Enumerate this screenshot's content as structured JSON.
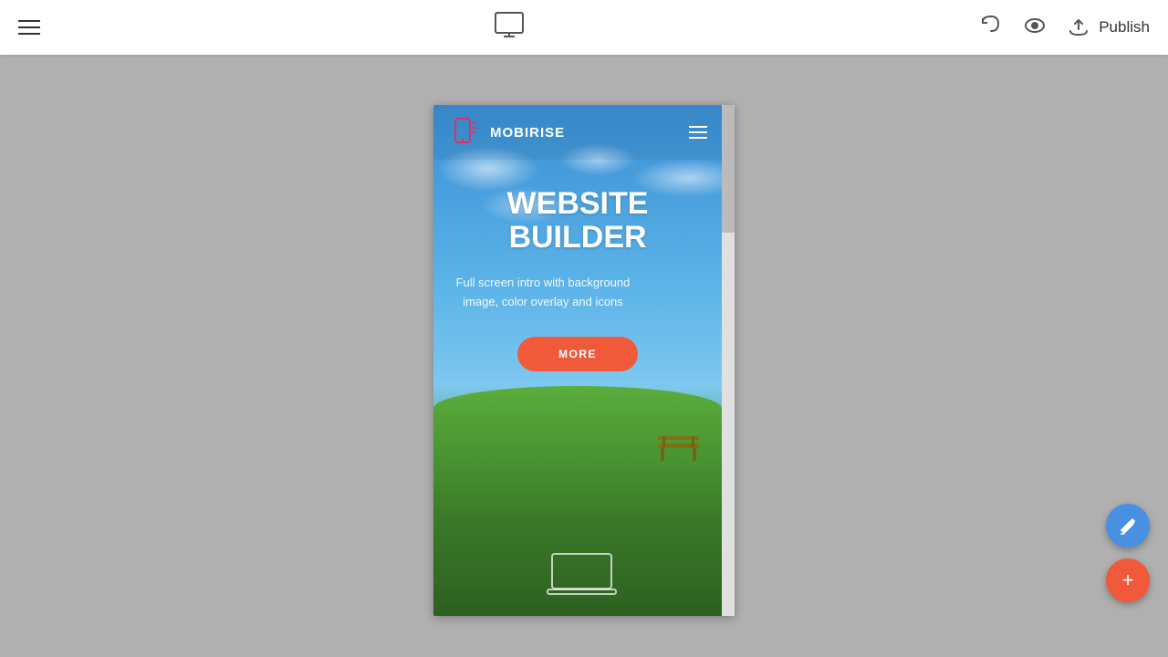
{
  "toolbar": {
    "publish_label": "Publish",
    "hamburger_aria": "Menu",
    "monitor_aria": "Desktop view",
    "undo_aria": "Undo",
    "eye_aria": "Preview"
  },
  "preview": {
    "brand_name": "MOBIRISE",
    "hero_title_line1": "WEBSITE",
    "hero_title_line2": "BUILDER",
    "hero_subtitle": "Full screen intro with background image, color overlay and icons",
    "more_button_label": "MORE"
  },
  "fab": {
    "edit_icon": "✏",
    "add_icon": "+"
  },
  "colors": {
    "publish_btn_bg": "#f05a3a",
    "fab_edit_bg": "#4a90e2",
    "fab_add_bg": "#f05a3a"
  }
}
